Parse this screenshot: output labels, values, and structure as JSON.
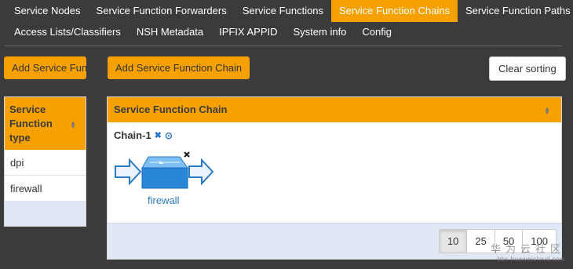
{
  "nav": {
    "row1": [
      "Service Nodes",
      "Service Function Forwarders",
      "Service Functions",
      "Service Function Chains",
      "Service Function Paths"
    ],
    "row2": [
      "Access Lists/Classifiers",
      "NSH Metadata",
      "IPFIX APPID",
      "System info",
      "Config"
    ],
    "active": "Service Function Chains"
  },
  "toolbar": {
    "add_sf_label": "Add Service Function",
    "add_sfc_label": "Add Service Function Chain",
    "clear_sorting_label": "Clear sorting"
  },
  "left_table": {
    "header": "Service Function type",
    "rows": [
      "dpi",
      "firewall"
    ]
  },
  "main_table": {
    "header": "Service Function Chain",
    "chain": {
      "name": "Chain-1",
      "functions": [
        "firewall"
      ]
    }
  },
  "pagination": {
    "options": [
      "10",
      "25",
      "50",
      "100"
    ],
    "selected": "10"
  },
  "watermark": {
    "line1": "华为云社区",
    "line2": "bbs.huaweicloud.com"
  },
  "colors": {
    "accent": "#f7a100",
    "background": "#3b3b3d",
    "link": "#2a7ac7",
    "footer": "#dfe8f4"
  }
}
